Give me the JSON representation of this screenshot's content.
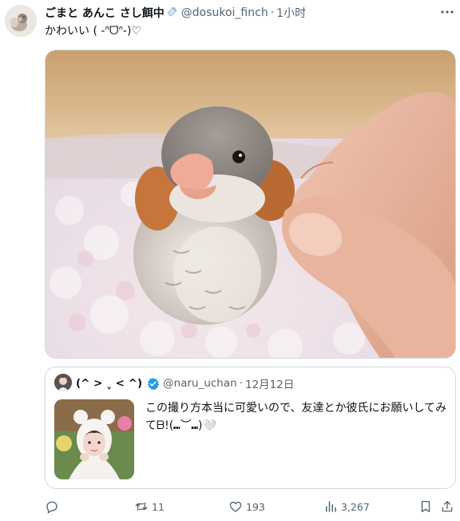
{
  "author": {
    "display_name": "ごまと あんこ さし餌中",
    "handle": "@dosukoi_finch",
    "separator": "·",
    "time": "1小时"
  },
  "tweet_text": "かわいい ( -ᐢᗜᐢ-)♡",
  "quoted": {
    "display_name": "(^ > ˬ < ^)",
    "handle": "@naru_uchan",
    "separator": "·",
    "time": "12月12日",
    "text": "この撮り方本当に可愛いので、友達とか彼氏にお願いしてみてᗷ!(⑉︶⑉)🤍"
  },
  "actions": {
    "replies": "",
    "retweets": "11",
    "likes": "193",
    "views": "3,267"
  },
  "colors": {
    "text_primary": "#0f1419",
    "text_secondary": "#536471",
    "border": "#cfd9de",
    "verified": "#1d9bf0"
  }
}
